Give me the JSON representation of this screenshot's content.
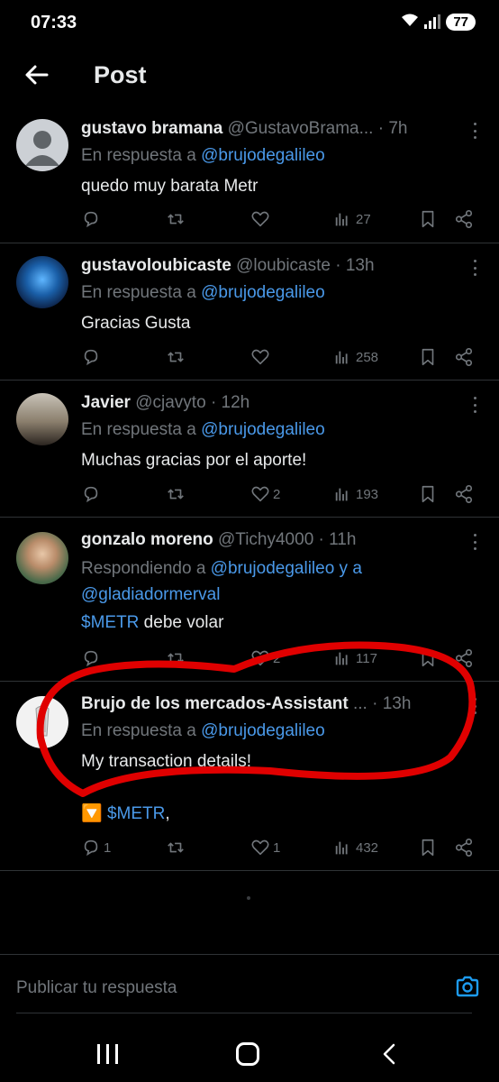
{
  "status_bar": {
    "time": "07:33",
    "battery": "77"
  },
  "header": {
    "title": "Post"
  },
  "replies": [
    {
      "name": "gustavo bramana",
      "handle": "@GustavoBrama...",
      "time": "· 7h",
      "context_prefix": "En respuesta a",
      "context_mention": "@brujodegalileo",
      "text": "quedo muy barata Metr",
      "replies_count": "",
      "retweets_count": "",
      "likes_count": "",
      "views_count": "27"
    },
    {
      "name": "gustavoloubicaste",
      "handle": "@loubicaste",
      "time": "· 13h",
      "context_prefix": "En respuesta a",
      "context_mention": "@brujodegalileo",
      "text": "Gracias Gusta",
      "replies_count": "",
      "retweets_count": "",
      "likes_count": "",
      "views_count": "258"
    },
    {
      "name": "Javier",
      "handle": "@cjavyto",
      "time": "· 12h",
      "context_prefix": "En respuesta a",
      "context_mention": "@brujodegalileo",
      "text": "Muchas gracias por el aporte!",
      "replies_count": "",
      "retweets_count": "",
      "likes_count": "2",
      "views_count": "193"
    },
    {
      "name": "gonzalo moreno",
      "handle": "@Tichy4000",
      "time": "· 11h",
      "context_prefix": "Respondiendo a",
      "context_mention": "@brujodegalileo y a",
      "context_mention2": "@gladiadormerval",
      "cashtag": "$METR",
      "text": " debe volar",
      "replies_count": "",
      "retweets_count": "",
      "likes_count": "2",
      "views_count": "117"
    },
    {
      "name": "Brujo de los mercados-Assistant",
      "handle": "...",
      "time": "· 13h",
      "context_prefix": "En respuesta a",
      "context_mention": "@brujodegalileo",
      "text": "My transaction details!",
      "line2_emoji": "🔽",
      "cashtag": "$METR",
      "line2_rest": ",",
      "replies_count": "1",
      "retweets_count": "",
      "likes_count": "1",
      "views_count": "432"
    }
  ],
  "composer": {
    "placeholder": "Publicar tu respuesta"
  },
  "colors": {
    "accent": "#4a99e9",
    "annotation": "#e00000",
    "muted": "#71767b"
  }
}
